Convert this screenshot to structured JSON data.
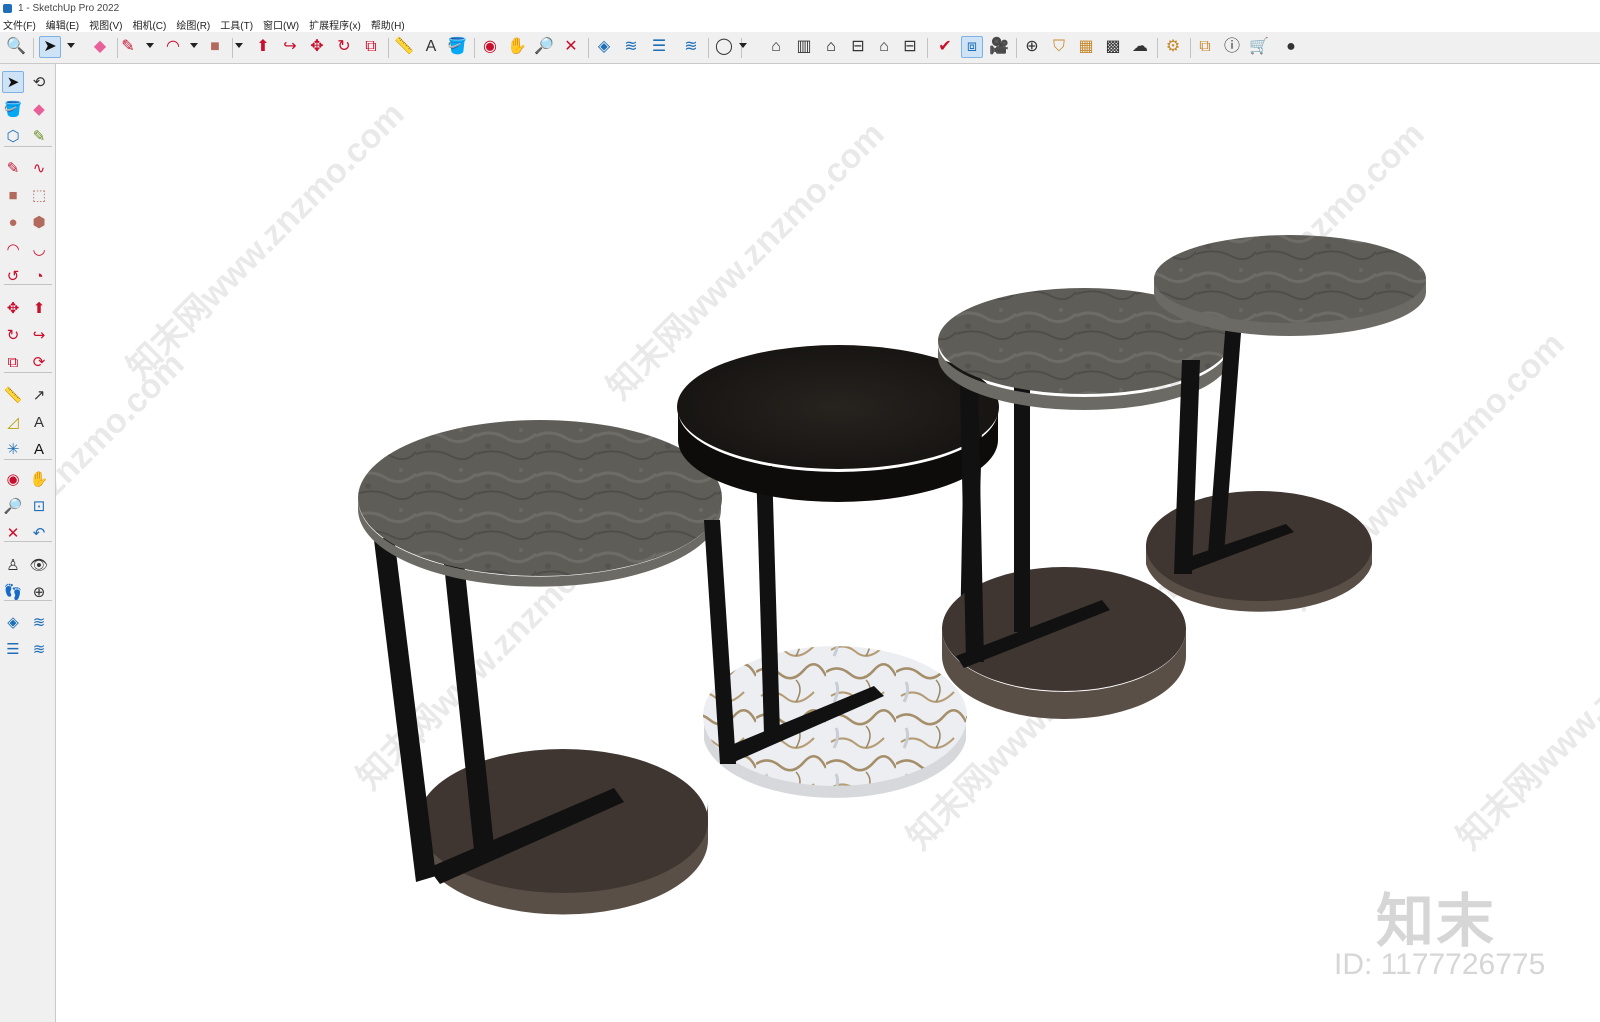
{
  "titlebar": {
    "title": "1 - SketchUp Pro 2022"
  },
  "menubar": {
    "items": [
      "文件(F)",
      "编辑(E)",
      "视图(V)",
      "相机(C)",
      "绘图(R)",
      "工具(T)",
      "窗口(W)",
      "扩展程序(x)",
      "帮助(H)"
    ]
  },
  "toolbar": {
    "buttons": [
      {
        "name": "zoom-window-icon",
        "glyph": "🔍",
        "color": "#222222"
      },
      {
        "name": "select-icon",
        "glyph": "➤",
        "color": "#111111",
        "active": true
      },
      {
        "name": "eraser-icon",
        "glyph": "◆",
        "color": "#e8609a"
      },
      {
        "name": "pencil-line-icon",
        "glyph": "✎",
        "color": "#c8102e"
      },
      {
        "name": "arc-icon",
        "glyph": "◠",
        "color": "#c8102e"
      },
      {
        "name": "rectangle-icon",
        "glyph": "■",
        "color": "#b36a5e"
      },
      {
        "name": "push-pull-icon",
        "glyph": "⬆",
        "color": "#c8102e"
      },
      {
        "name": "follow-me-icon",
        "glyph": "↪",
        "color": "#c8102e"
      },
      {
        "name": "move-icon",
        "glyph": "✥",
        "color": "#c8102e"
      },
      {
        "name": "rotate-icon",
        "glyph": "↻",
        "color": "#c8102e"
      },
      {
        "name": "scale-icon",
        "glyph": "⧉",
        "color": "#c8102e"
      },
      {
        "name": "tape-measure-icon",
        "glyph": "📏",
        "color": "#b8a000"
      },
      {
        "name": "text-icon",
        "glyph": "A",
        "color": "#333333"
      },
      {
        "name": "paint-bucket-icon",
        "glyph": "🪣",
        "color": "#6a8d1e"
      },
      {
        "name": "orbit-icon",
        "glyph": "◉",
        "color": "#c8102e"
      },
      {
        "name": "pan-icon",
        "glyph": "✋",
        "color": "#c68a2e"
      },
      {
        "name": "zoom-icon",
        "glyph": "🔎",
        "color": "#1e6fb8"
      },
      {
        "name": "zoom-extents-icon",
        "glyph": "✕",
        "color": "#c8102e"
      },
      {
        "name": "warehouse-icon",
        "glyph": "◈",
        "color": "#1e6fb8"
      },
      {
        "name": "extension-warehouse-icon",
        "glyph": "≋",
        "color": "#1e6fb8"
      },
      {
        "name": "layout-icon",
        "glyph": "☰",
        "color": "#1e6fb8"
      },
      {
        "name": "extension-manager-icon",
        "glyph": "≋",
        "color": "#1e6fb8"
      },
      {
        "name": "user-account-icon",
        "glyph": "◯",
        "color": "#333333"
      },
      {
        "name": "iso-view-icon",
        "glyph": "⌂",
        "color": "#333333"
      },
      {
        "name": "top-view-icon",
        "glyph": "▥",
        "color": "#333333"
      },
      {
        "name": "front-view-icon",
        "glyph": "⌂",
        "color": "#111111"
      },
      {
        "name": "right-view-icon",
        "glyph": "⊟",
        "color": "#333333"
      },
      {
        "name": "back-view-icon",
        "glyph": "⌂",
        "color": "#333333"
      },
      {
        "name": "left-view-icon",
        "glyph": "⊟",
        "color": "#333333"
      },
      {
        "name": "solid-tools-icon",
        "glyph": "✔",
        "color": "#c8102e"
      },
      {
        "name": "section-plane-icon",
        "glyph": "⧈",
        "color": "#1e6fb8",
        "active": true
      },
      {
        "name": "scenes-icon",
        "glyph": "🎥",
        "color": "#333333"
      },
      {
        "name": "add-location-icon",
        "glyph": "⊕",
        "color": "#333333"
      },
      {
        "name": "shadows-icon",
        "glyph": "⛉",
        "color": "#c68a2e"
      },
      {
        "name": "fog-icon",
        "glyph": "▦",
        "color": "#c68a2e"
      },
      {
        "name": "materials-icon",
        "glyph": "▩",
        "color": "#333333"
      },
      {
        "name": "cloud-upload-icon",
        "glyph": "☁",
        "color": "#333333"
      },
      {
        "name": "settings-icon",
        "glyph": "⚙",
        "color": "#c68a2e"
      },
      {
        "name": "outliner-icon",
        "glyph": "⧉",
        "color": "#c68a2e"
      },
      {
        "name": "info-icon",
        "glyph": "ⓘ",
        "color": "#333333"
      },
      {
        "name": "cart-icon",
        "glyph": "🛒",
        "color": "#333333"
      },
      {
        "name": "profile-icon",
        "glyph": "●",
        "color": "#333333"
      }
    ]
  },
  "lefttoolbar": {
    "buttons": [
      {
        "name": "select-icon",
        "glyph": "➤",
        "color": "#111111",
        "active": true
      },
      {
        "name": "lasso-select-icon",
        "glyph": "⟲",
        "color": "#333333"
      },
      {
        "name": "paint-bucket-icon",
        "glyph": "🪣",
        "color": "#6a8d1e"
      },
      {
        "name": "eraser-icon",
        "glyph": "◆",
        "color": "#e8609a"
      },
      {
        "name": "make-component-icon",
        "glyph": "⬡",
        "color": "#1e6fb8"
      },
      {
        "name": "tag-tool-icon",
        "glyph": "✎",
        "color": "#6a8d1e"
      },
      {
        "name": "pencil-line-icon",
        "glyph": "✎",
        "color": "#c8102e"
      },
      {
        "name": "freehand-icon",
        "glyph": "∿",
        "color": "#c8102e"
      },
      {
        "name": "rectangle-icon",
        "glyph": "■",
        "color": "#b36a5e"
      },
      {
        "name": "rotated-rectangle-icon",
        "glyph": "⬚",
        "color": "#b36a5e"
      },
      {
        "name": "circle-icon",
        "glyph": "●",
        "color": "#b36a5e"
      },
      {
        "name": "polygon-icon",
        "glyph": "⬢",
        "color": "#b36a5e"
      },
      {
        "name": "arc-icon",
        "glyph": "◠",
        "color": "#c8102e"
      },
      {
        "name": "two-point-arc-icon",
        "glyph": "◡",
        "color": "#c8102e"
      },
      {
        "name": "three-point-arc-icon",
        "glyph": "↺",
        "color": "#c8102e"
      },
      {
        "name": "pie-icon",
        "glyph": "◔",
        "color": "#c8102e"
      },
      {
        "name": "move-icon",
        "glyph": "✥",
        "color": "#c8102e"
      },
      {
        "name": "push-pull-icon",
        "glyph": "⬆",
        "color": "#c8102e"
      },
      {
        "name": "rotate-icon",
        "glyph": "↻",
        "color": "#c8102e"
      },
      {
        "name": "follow-me-icon",
        "glyph": "↪",
        "color": "#c8102e"
      },
      {
        "name": "scale-icon",
        "glyph": "⧉",
        "color": "#c8102e"
      },
      {
        "name": "offset-icon",
        "glyph": "⟳",
        "color": "#c8102e"
      },
      {
        "name": "tape-measure-icon",
        "glyph": "📏",
        "color": "#b8a000"
      },
      {
        "name": "dimension-icon",
        "glyph": "↗",
        "color": "#333333"
      },
      {
        "name": "protractor-icon",
        "glyph": "◿",
        "color": "#b8a000"
      },
      {
        "name": "text-icon",
        "glyph": "A",
        "color": "#333333"
      },
      {
        "name": "axes-icon",
        "glyph": "✳",
        "color": "#1e6fb8"
      },
      {
        "name": "3d-text-icon",
        "glyph": "A",
        "color": "#111111"
      },
      {
        "name": "orbit-icon",
        "glyph": "◉",
        "color": "#c8102e"
      },
      {
        "name": "pan-icon",
        "glyph": "✋",
        "color": "#c68a2e"
      },
      {
        "name": "zoom-icon",
        "glyph": "🔎",
        "color": "#1e6fb8"
      },
      {
        "name": "zoom-window-icon",
        "glyph": "⊡",
        "color": "#1e6fb8"
      },
      {
        "name": "zoom-extents-icon",
        "glyph": "✕",
        "color": "#c8102e"
      },
      {
        "name": "previous-view-icon",
        "glyph": "↶",
        "color": "#1e6fb8"
      },
      {
        "name": "position-camera-icon",
        "glyph": "♙",
        "color": "#333333"
      },
      {
        "name": "look-around-icon",
        "glyph": "👁",
        "color": "#333333"
      },
      {
        "name": "walk-icon",
        "glyph": "👣",
        "color": "#333333"
      },
      {
        "name": "section-plane-icon",
        "glyph": "⊕",
        "color": "#333333"
      },
      {
        "name": "warehouse-icon",
        "glyph": "◈",
        "color": "#1e6fb8"
      },
      {
        "name": "extension-warehouse-icon",
        "glyph": "≋",
        "color": "#1e6fb8"
      },
      {
        "name": "layout-icon",
        "glyph": "☰",
        "color": "#1e6fb8"
      },
      {
        "name": "extension-manager-icon",
        "glyph": "≋",
        "color": "#1e6fb8"
      }
    ]
  },
  "viewport": {
    "watermark": "知末网www.znzmo.com",
    "brand_logo": "知末",
    "brand_id": "ID: 1177726775",
    "tables": [
      {
        "name": "table-1",
        "top": "gray-marble",
        "base": "dark-brown"
      },
      {
        "name": "table-2",
        "top": "black",
        "base": "white-marble"
      },
      {
        "name": "table-3",
        "top": "gray-marble",
        "base": "dark-brown"
      },
      {
        "name": "table-4",
        "top": "gray-marble",
        "base": "dark-brown"
      }
    ]
  },
  "colors": {
    "ui_background": "#f0f0f0",
    "active_button": "#cfe3f7",
    "frame_black": "#111111",
    "marble_gray": "#5e5d58",
    "top_black": "#1c1a18",
    "base_brown": "#3f3631",
    "marble_white": "#eceef2"
  }
}
